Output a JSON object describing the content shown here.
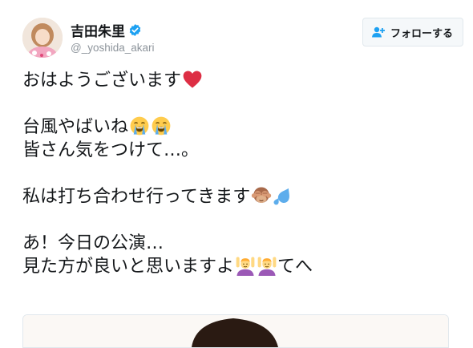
{
  "tweet": {
    "display_name": "吉田朱里",
    "handle": "@_yoshida_akari",
    "follow_label": "フォローする",
    "lines": {
      "l1": "おはようございます",
      "l2": "台風やばいね",
      "l3": "皆さん気をつけて…。",
      "l4": "私は打ち合わせ行ってきます",
      "l5": "あ！今日の公演…",
      "l6a": "見た方が良いと思いますよ",
      "l6b": "てへ"
    }
  },
  "icons": {
    "verified": "verified-badge-icon",
    "follow": "add-user-icon",
    "heart": "red-heart-emoji",
    "crying": "loudly-crying-face-emoji",
    "monkey": "see-no-evil-monkey-emoji",
    "sweat": "sweat-droplets-emoji",
    "woman": "woman-raising-hands-emoji"
  },
  "colors": {
    "verified_blue": "#1da1f2",
    "heart_red": "#dd2e44",
    "handle_gray": "#8e959c"
  }
}
